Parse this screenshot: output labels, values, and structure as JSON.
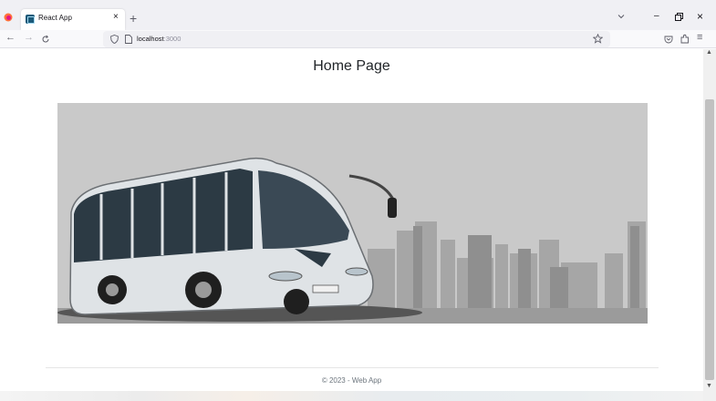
{
  "browser": {
    "tab": {
      "title": "React App",
      "close": "×"
    },
    "new_tab": "+",
    "window": {
      "minimize": "–",
      "close": "×"
    },
    "nav": {
      "back": "←",
      "forward": "→",
      "menu": "≡"
    },
    "url": {
      "host": "localhost",
      "port": ":3000"
    }
  },
  "page": {
    "title": "Home Page",
    "hero_image": "bus-image",
    "footer": "© 2023 - Web App"
  },
  "scrollbar": {
    "up": "▲",
    "down": "▼"
  },
  "colors": {
    "heading": "#212529",
    "footer": "#6c757d",
    "tab_favicon": "#1c5a79"
  }
}
